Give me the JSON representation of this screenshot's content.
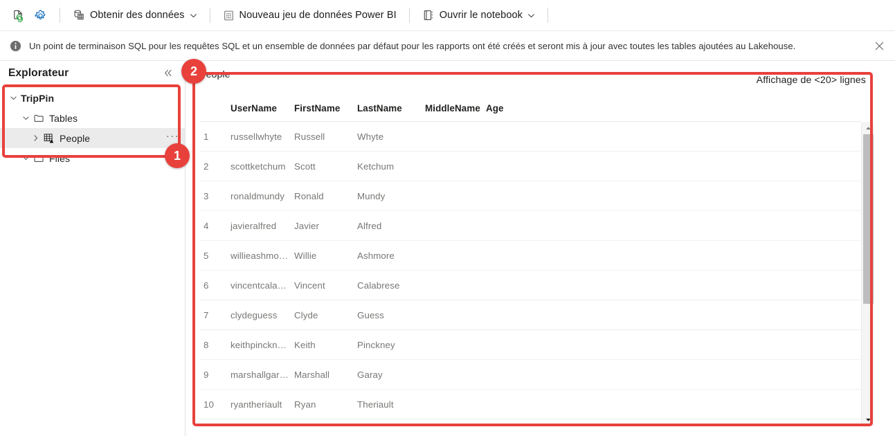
{
  "toolbar": {
    "refresh_icon": "refresh-page-icon",
    "settings_icon": "gear-icon",
    "items": [
      {
        "label": "Obtenir des données",
        "icon": "database-table-icon",
        "has_chevron": true
      },
      {
        "label": "Nouveau jeu de données Power BI",
        "icon": "dataset-grid-icon",
        "has_chevron": false
      },
      {
        "label": "Ouvrir le notebook",
        "icon": "notebook-icon",
        "has_chevron": true
      }
    ]
  },
  "infobar": {
    "icon": "info-icon",
    "message": "Un point de terminaison SQL pour les requêtes SQL et un ensemble de données par défaut pour les rapports ont été créés et seront mis à jour avec toutes les tables ajoutées au Lakehouse.",
    "close_icon": "close-icon"
  },
  "explorer": {
    "title": "Explorateur",
    "collapse_icon": "chevron-double-left-icon",
    "tree": [
      {
        "label": "TripPin",
        "level": 0,
        "icon": "none",
        "twisty": "chevron-down",
        "selected": false,
        "more": ""
      },
      {
        "label": "Tables",
        "level": 1,
        "icon": "folder-icon",
        "twisty": "chevron-down",
        "selected": false,
        "more": ""
      },
      {
        "label": "People",
        "level": 2,
        "icon": "delta-table-icon",
        "twisty": "chevron-right",
        "selected": true,
        "more": "···"
      },
      {
        "label": "Files",
        "level": 1,
        "icon": "folder-icon",
        "twisty": "chevron-down",
        "selected": false,
        "more": ""
      }
    ]
  },
  "table_view": {
    "title": "People",
    "rows_label": "Affichage de <20> lignes",
    "columns": [
      "",
      "UserName",
      "FirstName",
      "LastName",
      "MiddleName",
      "Age"
    ],
    "rows": [
      {
        "idx": "1",
        "UserName": "russellwhyte",
        "FirstName": "Russell",
        "LastName": "Whyte",
        "MiddleName": "",
        "Age": ""
      },
      {
        "idx": "2",
        "UserName": "scottketchum",
        "FirstName": "Scott",
        "LastName": "Ketchum",
        "MiddleName": "",
        "Age": ""
      },
      {
        "idx": "3",
        "UserName": "ronaldmundy",
        "FirstName": "Ronald",
        "LastName": "Mundy",
        "MiddleName": "",
        "Age": ""
      },
      {
        "idx": "4",
        "UserName": "javieralfred",
        "FirstName": "Javier",
        "LastName": "Alfred",
        "MiddleName": "",
        "Age": ""
      },
      {
        "idx": "5",
        "UserName": "willieashmo…",
        "FirstName": "Willie",
        "LastName": "Ashmore",
        "MiddleName": "",
        "Age": ""
      },
      {
        "idx": "6",
        "UserName": "vincentcala…",
        "FirstName": "Vincent",
        "LastName": "Calabrese",
        "MiddleName": "",
        "Age": ""
      },
      {
        "idx": "7",
        "UserName": "clydeguess",
        "FirstName": "Clyde",
        "LastName": "Guess",
        "MiddleName": "",
        "Age": ""
      },
      {
        "idx": "8",
        "UserName": "keithpinckn…",
        "FirstName": "Keith",
        "LastName": "Pinckney",
        "MiddleName": "",
        "Age": ""
      },
      {
        "idx": "9",
        "UserName": "marshallgar…",
        "FirstName": "Marshall",
        "LastName": "Garay",
        "MiddleName": "",
        "Age": ""
      },
      {
        "idx": "10",
        "UserName": "ryantheriault",
        "FirstName": "Ryan",
        "LastName": "Theriault",
        "MiddleName": "",
        "Age": ""
      }
    ],
    "scrollbar": {
      "up_icon": "scroll-up-arrow-icon",
      "down_icon": "scroll-down-arrow-icon"
    }
  },
  "annotations": [
    {
      "number": "1",
      "target": "explorer-tree-trippin-tables-people"
    },
    {
      "number": "2",
      "target": "table-preview-panel"
    }
  ],
  "colors": {
    "annotation_red": "#e8413c",
    "accent_blue": "#0078d4",
    "icon_green": "#4caf50",
    "text_primary": "#201f1e",
    "text_secondary": "#797775"
  }
}
